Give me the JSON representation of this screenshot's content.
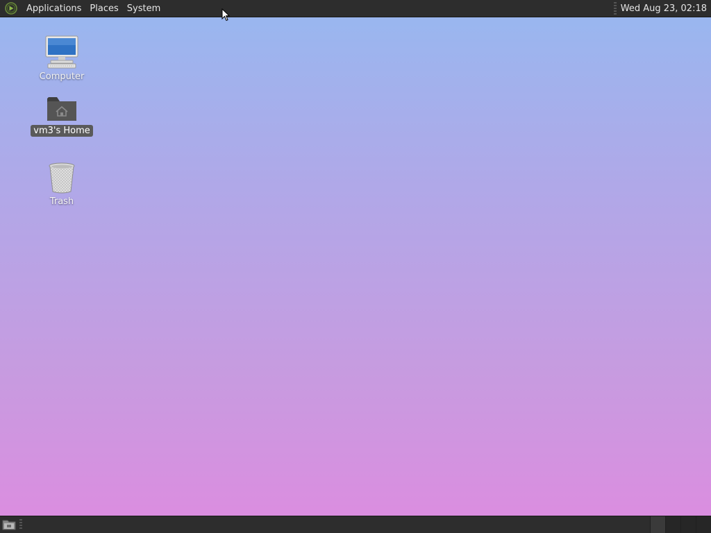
{
  "top_panel": {
    "menus": [
      "Applications",
      "Places",
      "System"
    ],
    "clock": "Wed Aug 23, 02:18",
    "logo_icon": "mate-logo-icon"
  },
  "desktop": {
    "icons": [
      {
        "label": "Computer",
        "icon": "computer-icon",
        "selected": false
      },
      {
        "label": "vm3's Home",
        "icon": "home-folder-icon",
        "selected": true
      },
      {
        "label": "Trash",
        "icon": "trash-icon",
        "selected": false
      }
    ],
    "colors": {
      "gradient_top": "#97b8f0",
      "gradient_bottom": "#dd8ce0"
    }
  },
  "bottom_panel": {
    "show_desktop_icon": "show-desktop-icon",
    "workspace_count": 4,
    "active_workspace": 1
  }
}
